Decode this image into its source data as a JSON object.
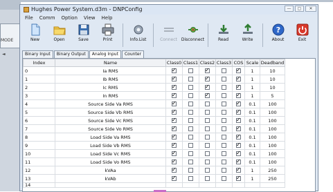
{
  "background": {
    "left_window_label": "MODE",
    "left_window_arrow": "◄"
  },
  "window": {
    "title": "Hughes Power System.d3m - DNPConfig",
    "buttons": {
      "minimize": "—",
      "maximize": "▢",
      "close": "✕"
    }
  },
  "menu": [
    "File",
    "Comm",
    "Option",
    "View",
    "Help"
  ],
  "toolbar": [
    {
      "label": "New",
      "icon": "new-document-icon",
      "enabled": true
    },
    {
      "label": "Open",
      "icon": "open-folder-icon",
      "enabled": true
    },
    {
      "label": "Save",
      "icon": "save-disk-icon",
      "enabled": true
    },
    {
      "label": "Print",
      "icon": "printer-icon",
      "enabled": true
    },
    {
      "label": "Info.List",
      "icon": "gear-list-icon",
      "enabled": true
    },
    {
      "label": "Connect",
      "icon": "connect-plug-icon",
      "enabled": false
    },
    {
      "label": "Disconnect",
      "icon": "disconnect-plug-icon",
      "enabled": true
    },
    {
      "label": "Read",
      "icon": "read-arrow-icon",
      "enabled": true
    },
    {
      "label": "Write",
      "icon": "write-arrow-icon",
      "enabled": true
    },
    {
      "label": "About",
      "icon": "help-question-icon",
      "enabled": true
    },
    {
      "label": "Exit",
      "icon": "exit-power-icon",
      "enabled": true
    }
  ],
  "tabs": [
    {
      "label": "Binary Input",
      "active": false
    },
    {
      "label": "Binary Output",
      "active": false
    },
    {
      "label": "Analog Input",
      "active": true
    },
    {
      "label": "Counter",
      "active": false
    }
  ],
  "table": {
    "columns": [
      "Index",
      "Name",
      "Class0",
      "Class1",
      "Class2",
      "Class3",
      "COS",
      "Scale",
      "Deadband"
    ],
    "rows": [
      {
        "index": "0",
        "name": "Ia RMS",
        "class0": true,
        "class1": false,
        "class2": true,
        "class3": false,
        "cos": true,
        "scale": "1",
        "deadband": "10"
      },
      {
        "index": "1",
        "name": "Ib RMS",
        "class0": true,
        "class1": false,
        "class2": true,
        "class3": false,
        "cos": true,
        "scale": "1",
        "deadband": "10"
      },
      {
        "index": "2",
        "name": "Ic RMS",
        "class0": true,
        "class1": false,
        "class2": true,
        "class3": false,
        "cos": true,
        "scale": "1",
        "deadband": "10"
      },
      {
        "index": "3",
        "name": "In RMS",
        "class0": true,
        "class1": false,
        "class2": true,
        "class3": false,
        "cos": true,
        "scale": "1",
        "deadband": "5"
      },
      {
        "index": "4",
        "name": "Source Side Va RMS",
        "class0": true,
        "class1": false,
        "class2": false,
        "class3": false,
        "cos": true,
        "scale": "0.1",
        "deadband": "100"
      },
      {
        "index": "5",
        "name": "Source Side Vb RMS",
        "class0": true,
        "class1": false,
        "class2": false,
        "class3": false,
        "cos": true,
        "scale": "0.1",
        "deadband": "100"
      },
      {
        "index": "6",
        "name": "Source Side Vc RMS",
        "class0": true,
        "class1": false,
        "class2": false,
        "class3": false,
        "cos": true,
        "scale": "0.1",
        "deadband": "100"
      },
      {
        "index": "7",
        "name": "Source Side Vo RMS",
        "class0": true,
        "class1": false,
        "class2": false,
        "class3": false,
        "cos": true,
        "scale": "0.1",
        "deadband": "100"
      },
      {
        "index": "8",
        "name": "Load Side Va RMS",
        "class0": true,
        "class1": false,
        "class2": false,
        "class3": false,
        "cos": true,
        "scale": "0.1",
        "deadband": "100"
      },
      {
        "index": "9",
        "name": "Load Side Vb RMS",
        "class0": true,
        "class1": false,
        "class2": false,
        "class3": false,
        "cos": true,
        "scale": "0.1",
        "deadband": "100"
      },
      {
        "index": "10",
        "name": "Load Side Vc RMS",
        "class0": true,
        "class1": false,
        "class2": false,
        "class3": false,
        "cos": true,
        "scale": "0.1",
        "deadband": "100"
      },
      {
        "index": "11",
        "name": "Load Side Vo RMS",
        "class0": true,
        "class1": false,
        "class2": false,
        "class3": false,
        "cos": true,
        "scale": "0.1",
        "deadband": "100"
      },
      {
        "index": "12",
        "name": "kVAa",
        "class0": true,
        "class1": false,
        "class2": false,
        "class3": false,
        "cos": true,
        "scale": "1",
        "deadband": "250"
      },
      {
        "index": "13",
        "name": "kVAb",
        "class0": true,
        "class1": false,
        "class2": false,
        "class3": false,
        "cos": true,
        "scale": "1",
        "deadband": "250"
      }
    ],
    "partial_row_index": "14"
  }
}
